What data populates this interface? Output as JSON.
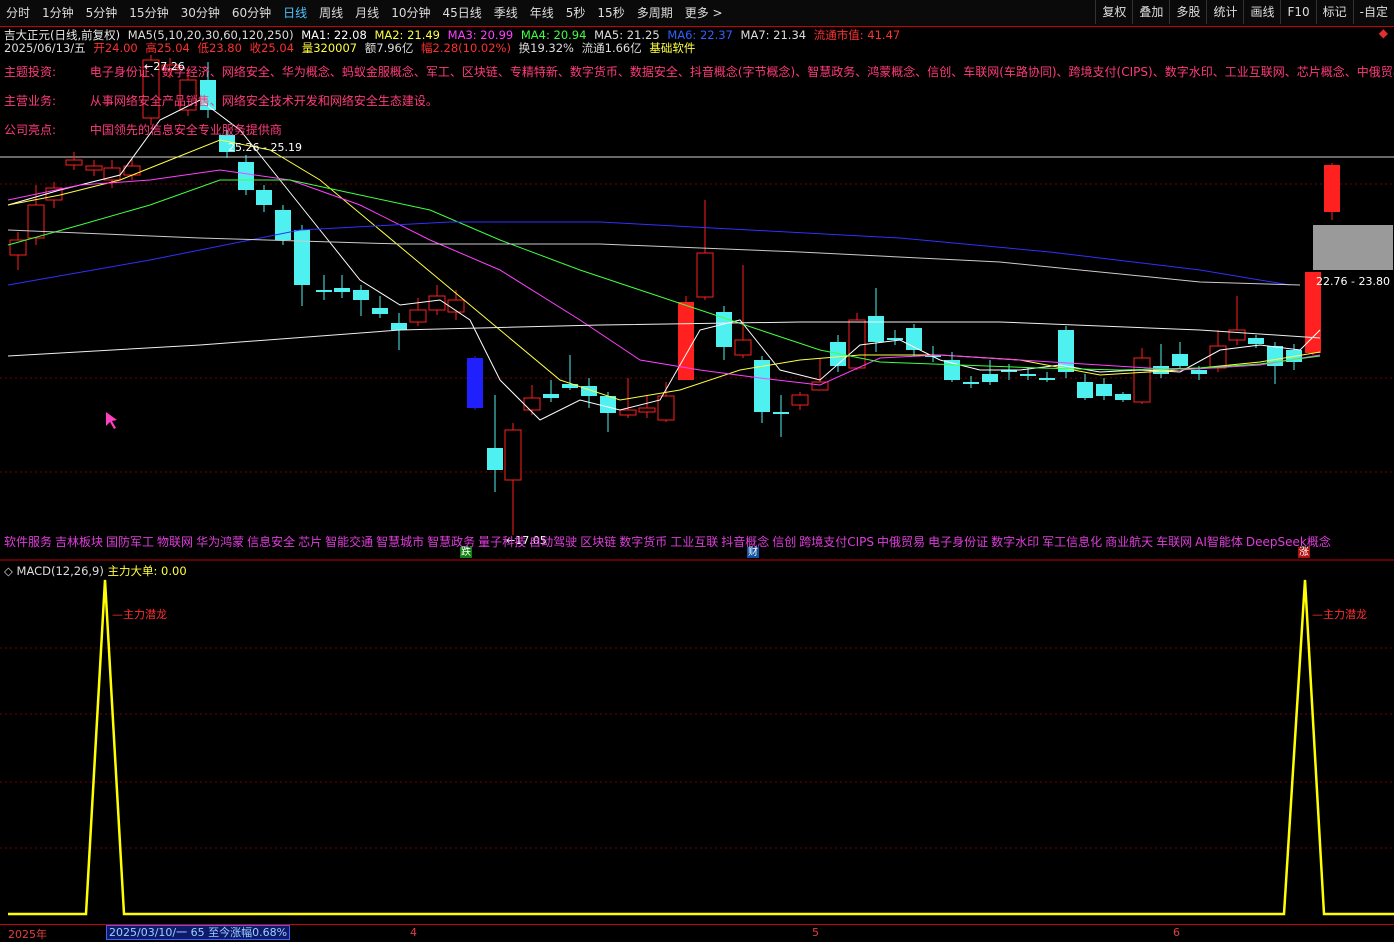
{
  "toolbar": {
    "periods": [
      "分时",
      "1分钟",
      "5分钟",
      "15分钟",
      "30分钟",
      "60分钟",
      "日线",
      "周线",
      "月线",
      "10分钟",
      "45日线",
      "季线",
      "年线",
      "5秒",
      "15秒",
      "多周期",
      "更多 >"
    ],
    "active_period": "日线",
    "right_buttons": [
      "复权",
      "叠加",
      "多股",
      "统计",
      "画线",
      "F10",
      "标记",
      "-自定"
    ]
  },
  "stock": {
    "title": "吉大正元(日线,前复权)",
    "ma_params": "MA5(5,10,20,30,60,120,250)",
    "ma1": "MA1: 22.08",
    "ma2": "MA2: 21.49",
    "ma3": "MA3: 20.99",
    "ma4": "MA4: 20.94",
    "ma5": "MA5: 21.25",
    "ma6": "MA6: 22.37",
    "ma7": "MA7: 21.34",
    "float_value": "流通市值: 41.47",
    "date": "2025/06/13/五",
    "open": "开24.00",
    "high": "高25.04",
    "low": "低23.80",
    "close": "收25.04",
    "volume": "量320007",
    "amount": "额7.96亿",
    "change": "幅2.28(10.02%)",
    "turnover": "换19.32%",
    "float_shares": "流通1.66亿",
    "sector": "基础软件",
    "close_icon": "close-x"
  },
  "f10": {
    "theme_label": "主题投资:",
    "theme_value": "电子身份证、数字经济、网络安全、华为概念、蚂蚁金服概念、军工、区块链、专精特新、数字货币、数据安全、抖音概念(字节概念)、智慧政务、鸿蒙概念、信创、车联网(车路协同)、跨境支付(CIPS)、数字水印、工业互联网、芯片概念、中俄贸易",
    "business_label": "主营业务:",
    "business_value": "从事网络安全产品销售、网络安全技术开发和网络安全生态建设。",
    "highlight_label": "公司亮点:",
    "highlight_value": "中国领先的信息安全专业服务提供商"
  },
  "price_labels": {
    "high_peak": "27.26",
    "line_level": "25.26 - 25.19",
    "low_point": "17.05",
    "right_range": "22.76 - 23.80"
  },
  "concepts": [
    "软件服务",
    "吉林板块",
    "国防军工",
    "物联网",
    "华为鸿蒙",
    "信息安全",
    "芯片",
    "智能交通",
    "智慧城市",
    "智慧政务",
    "量子科技",
    "自动驾驶",
    "区块链",
    "数字货币",
    "工业互联",
    "抖音概念",
    "信创",
    "跨境支付CIPS",
    "中俄贸易",
    "电子身份证",
    "数字水印",
    "军工信息化",
    "商业航天",
    "车联网",
    "AI智能体",
    "DeepSeek概念"
  ],
  "markers": {
    "drop": "跌",
    "finance": "财",
    "rise": "涨"
  },
  "macd": {
    "title": "MACD(12,26,9)",
    "main_label": "主力大单: 0.00",
    "signal_label": "主力潜龙"
  },
  "axis": {
    "year": "2025年",
    "range_text": "2025/03/10/一 65 至今涨幅0.68%",
    "month4": "4",
    "month5": "5",
    "month6": "6"
  },
  "colors": {
    "up": "#ff2020",
    "down": "#4ff0f0",
    "ma1": "#ffffff",
    "ma2": "#ffff40",
    "ma3": "#ff40ff",
    "ma4": "#40ff40",
    "ma6": "#3030ff",
    "macd_line": "#ffff00"
  }
}
